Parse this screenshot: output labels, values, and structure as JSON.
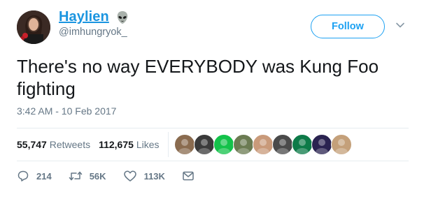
{
  "user": {
    "display_name": "Haylien",
    "emoji_icon": "alien-emoji-icon",
    "handle": "@imhungryok_"
  },
  "follow_button": {
    "label": "Follow"
  },
  "tweet": {
    "text": "There's no way EVERYBODY was Kung Foo fighting",
    "timestamp": "3:42 AM - 10 Feb 2017"
  },
  "stats": {
    "retweets_count": "55,747",
    "retweets_label": "Retweets",
    "likes_count": "112,675",
    "likes_label": "Likes"
  },
  "likers": [
    {
      "color": "#8a6b4f"
    },
    {
      "color": "#3a3a3a"
    },
    {
      "color": "#13c24a"
    },
    {
      "color": "#6b7b52"
    },
    {
      "color": "#c99a7a"
    },
    {
      "color": "#4a4a4a"
    },
    {
      "color": "#0d7a48"
    },
    {
      "color": "#2a2350"
    },
    {
      "color": "#c4a07a"
    }
  ],
  "actions": {
    "reply_count": "214",
    "retweet_count": "56K",
    "like_count": "113K"
  },
  "colors": {
    "accent": "#1da1f2",
    "name_link": "#1b95e0",
    "muted": "#657786"
  }
}
